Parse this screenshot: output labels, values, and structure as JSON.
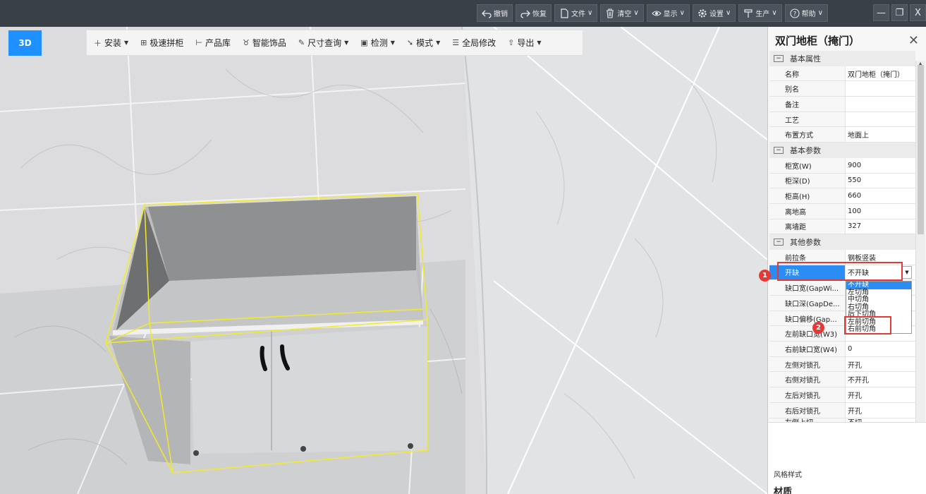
{
  "topbar": {
    "undo": "撤销",
    "redo": "恢复",
    "file": "文件",
    "clear": "清空",
    "display": "显示",
    "settings": "设置",
    "production": "生产",
    "help": "帮助"
  },
  "window": {
    "minimize": "—",
    "restore": "❐",
    "close": "X"
  },
  "viewport": {
    "view_button": "3D",
    "toolbar": {
      "install": "安装",
      "quick_assemble": "极速拼柜",
      "product_library": "产品库",
      "smart_decor": "智能饰品",
      "dimension_query": "尺寸查询",
      "check": "检测",
      "mode": "模式",
      "global_modify": "全局修改",
      "export": "导出"
    }
  },
  "panel": {
    "title": "双门地柜（掩门）",
    "groups": {
      "basic_props": "基本属性",
      "basic_params": "基本参数",
      "other_params": "其他参数"
    },
    "rows": {
      "name": {
        "k": "名称",
        "v": "双门地柜（掩门）"
      },
      "alias": {
        "k": "别名",
        "v": ""
      },
      "note": {
        "k": "备注",
        "v": ""
      },
      "craft": {
        "k": "工艺",
        "v": ""
      },
      "placement": {
        "k": "布置方式",
        "v": "地面上"
      },
      "width": {
        "k": "柜宽(W)",
        "v": "900"
      },
      "depth": {
        "k": "柜深(D)",
        "v": "550"
      },
      "height": {
        "k": "柜高(H)",
        "v": "660"
      },
      "floor_height": {
        "k": "离地高",
        "v": "100"
      },
      "wall_distance": {
        "k": "离墙距",
        "v": "327"
      },
      "front_strip": {
        "k": "前拉条",
        "v": "钢板竖装"
      },
      "notch": {
        "k": "开缺",
        "v": "不开缺"
      },
      "notch_width": {
        "k": "缺口宽(GapWi...",
        "v": ""
      },
      "notch_depth": {
        "k": "缺口深(GapDe...",
        "v": ""
      },
      "notch_offset": {
        "k": "缺口偏移(Gap...",
        "v": ""
      },
      "left_front_notch": {
        "k": "左前缺口宽(W3)",
        "v": ""
      },
      "right_front_notch": {
        "k": "右前缺口宽(W4)",
        "v": "0"
      },
      "left_lock_hole": {
        "k": "左侧对锁孔",
        "v": "开孔"
      },
      "right_lock_hole": {
        "k": "右侧对锁孔",
        "v": "不开孔"
      },
      "left_back_lock_hole": {
        "k": "左后对锁孔",
        "v": "开孔"
      },
      "right_back_lock_hole": {
        "k": "右后对锁孔",
        "v": "开孔"
      },
      "left_top_cut": {
        "k": "左侧上切",
        "v": "不切"
      }
    },
    "dropdown_options": [
      "不开缺",
      "左切角",
      "中切角",
      "右切角",
      "后下切角",
      "左前切角",
      "右前切角"
    ],
    "style_label": "风格样式",
    "material_label": "材质"
  },
  "callouts": {
    "one": "1",
    "two": "2"
  },
  "colors": {
    "accent": "#2b8cf3",
    "titlebar": "#3a4048",
    "callout": "#e53935",
    "selection_box": "#f2ea2a"
  }
}
